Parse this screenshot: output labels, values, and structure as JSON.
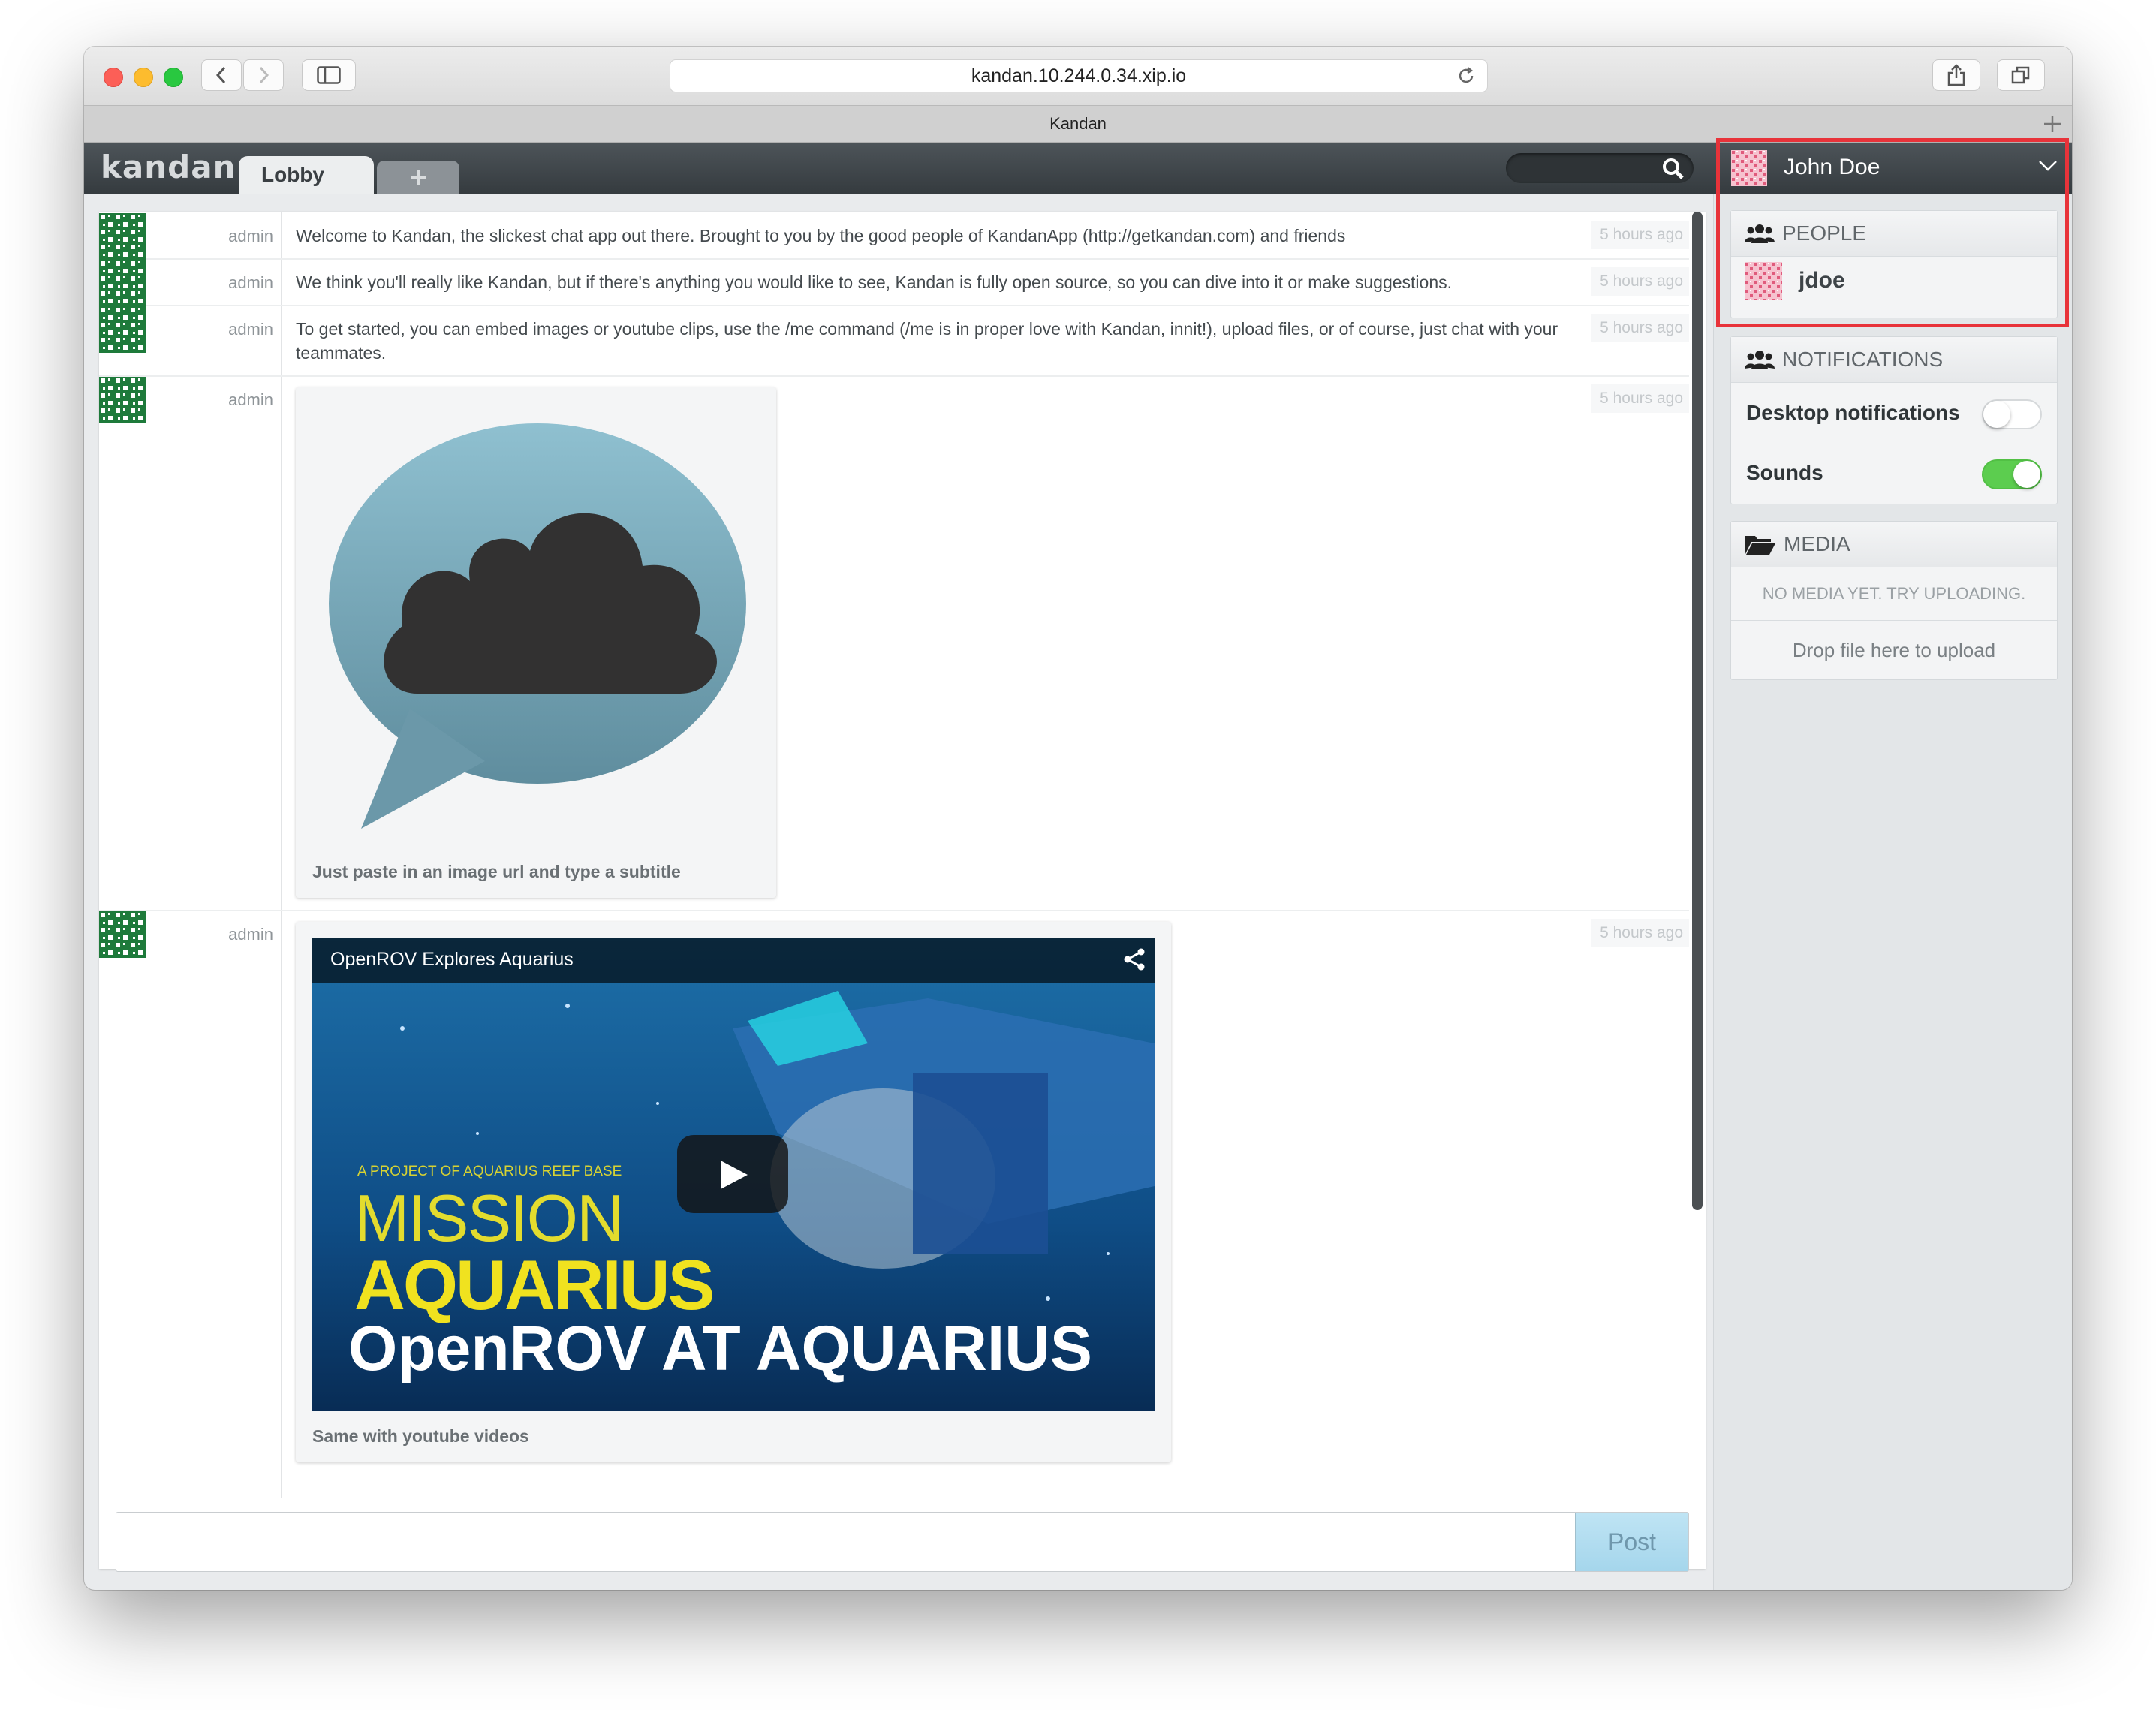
{
  "browser": {
    "url": "kandan.10.244.0.34.xip.io",
    "tab_title": "Kandan"
  },
  "app": {
    "logo": "kandan",
    "tabs": [
      {
        "label": "Lobby"
      }
    ],
    "add_tab_label": "+",
    "search": {
      "placeholder": ""
    }
  },
  "user": {
    "name": "John Doe"
  },
  "messages": [
    {
      "user": "admin",
      "text": "Welcome to Kandan, the slickest chat app out there. Brought to you by the good people of KandanApp (http://getkandan.com) and friends",
      "time": "5 hours ago"
    },
    {
      "user": "admin",
      "text": "We think you'll really like Kandan, but if there's anything you would like to see, Kandan is fully open source, so you can dive into it or make suggestions.",
      "time": "5 hours ago"
    },
    {
      "user": "admin",
      "text": "To get started, you can embed images or youtube clips, use the /me command (/me is in proper love with Kandan, innit!), upload files, or of course, just chat with your teammates.",
      "time": "5 hours ago"
    },
    {
      "user": "admin",
      "caption": "Just paste in an image url and type a subtitle",
      "time": "5 hours ago"
    },
    {
      "user": "admin",
      "caption": "Same with youtube videos",
      "time": "5 hours ago",
      "video": {
        "title": "OpenROV Explores Aquarius",
        "overlay_small": "A PROJECT OF AQUARIUS REEF BASE",
        "overlay_mission": "MISSION",
        "overlay_aquarius": "AQUARIUS",
        "overlay_openrov": "OpenROV AT AQUARIUS"
      }
    }
  ],
  "composer": {
    "placeholder": "",
    "post_label": "Post"
  },
  "sidebar": {
    "people": {
      "title": "PEOPLE",
      "members": [
        {
          "name": "jdoe"
        }
      ]
    },
    "notifications": {
      "title": "NOTIFICATIONS",
      "items": [
        {
          "label": "Desktop notifications",
          "enabled": false
        },
        {
          "label": "Sounds",
          "enabled": true
        }
      ]
    },
    "media": {
      "title": "MEDIA",
      "empty": "NO MEDIA YET. TRY UPLOADING.",
      "drop": "Drop file here to upload"
    }
  },
  "colors": {
    "accent_green": "#5ccd4f",
    "highlight_red": "#e8333a",
    "navbar": "#3d4347"
  }
}
